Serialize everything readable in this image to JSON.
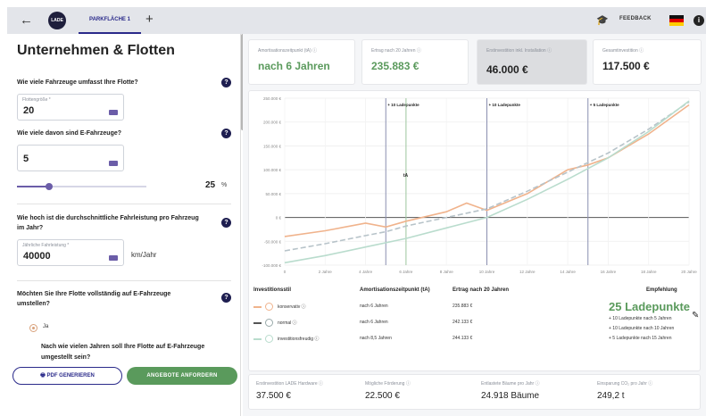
{
  "topbar": {
    "logo_text": "LADE",
    "tab_label": "PARKFLÄCHE 1",
    "feedback_label": "FEEDBACK"
  },
  "left": {
    "title": "Unternehmen & Flotten",
    "q_fleet": "Wie viele Fahrzeuge umfasst Ihre Flotte?",
    "fleet_label": "Flottengröße *",
    "fleet_value": "20",
    "q_ev": "Wie viele davon sind E-Fahrzeuge?",
    "ev_value": "5",
    "ev_share": 25,
    "ev_share_text": "25",
    "pct_sign": "%",
    "q_mileage": "Wie hoch ist die durchschnittliche Fahrleistung pro Fahrzeug im Jahr?",
    "mileage_label": "Jährliche Fahrleistung *",
    "mileage_value": "40000",
    "mileage_unit": "km/Jahr",
    "q_full": "Möchten Sie Ihre Flotte vollständig auf E-Fahrzeuge umstellen?",
    "radio_yes": "Ja",
    "q_years": "Nach wie vielen Jahren soll Ihre Flotte auf E-Fahrzeuge umgestellt sein?",
    "btn_pdf": "PDF GENERIEREN",
    "btn_offer": "ANGEBOTE ANFORDERN"
  },
  "cards": [
    {
      "label": "Amortisationszeitpunkt (tA) ⓘ",
      "value": "nach 6 Jahren",
      "color": "#5a9a5c"
    },
    {
      "label": "Ertrag nach 20 Jahren ⓘ",
      "value": "235.883 €",
      "color": "#5a9a5c"
    },
    {
      "label": "Erstinvestition inkl. Installation ⓘ",
      "value": "46.000 €",
      "color": "#222222"
    },
    {
      "label": "Gesamtinvestition ⓘ",
      "value": "117.500 €",
      "color": "#222222"
    }
  ],
  "chart_data": {
    "type": "line",
    "x_ticks": [
      "0",
      "2 Jahre",
      "4 Jahre",
      "6 Jahre",
      "8 Jahre",
      "10 Jahre",
      "12 Jahre",
      "14 Jahre",
      "16 Jahre",
      "18 Jahre",
      "20 Jahre"
    ],
    "y_ticks": [
      "250.000 €",
      "200.000 €",
      "150.000 €",
      "100.000 €",
      "50.000 €",
      "0 €",
      "-50.000 €",
      "-100.000 €"
    ],
    "ylim": [
      -100000,
      250000
    ],
    "xlim": [
      0,
      20
    ],
    "marker_label": "tA",
    "marker_x": 6,
    "vlines": [
      {
        "x": 5,
        "label": "+ 10 Ladepunkte"
      },
      {
        "x": 10,
        "label": "+ 10 Ladepunkte"
      },
      {
        "x": 15,
        "label": "+ 5 Ladepunkte"
      }
    ],
    "series": [
      {
        "name": "konservativ",
        "color": "#f0b38c",
        "style": "solid",
        "x": [
          0,
          2,
          4,
          5,
          6,
          8,
          9,
          10,
          12,
          14,
          15,
          16,
          18,
          20
        ],
        "y": [
          -40000,
          -28000,
          -12000,
          -20000,
          -8000,
          12000,
          30000,
          15000,
          50000,
          100000,
          110000,
          125000,
          175000,
          235883
        ]
      },
      {
        "name": "normal",
        "color": "#b7c3c9",
        "style": "dashed",
        "x": [
          0,
          2,
          4,
          5,
          6,
          8,
          10,
          12,
          14,
          16,
          18,
          20
        ],
        "y": [
          -70000,
          -55000,
          -38000,
          -30000,
          -18000,
          0,
          18000,
          55000,
          95000,
          135000,
          185000,
          242133
        ]
      },
      {
        "name": "investitionsfreudig",
        "color": "#b9dccd",
        "style": "solid",
        "x": [
          0,
          2,
          4,
          6,
          8,
          10,
          12,
          14,
          16,
          18,
          20
        ],
        "y": [
          -95000,
          -80000,
          -62000,
          -44000,
          -22000,
          0,
          38000,
          80000,
          125000,
          180000,
          244133
        ]
      }
    ]
  },
  "table": {
    "h_style": "Investitionsstil",
    "h_ta": "Amortisationszeitpunkt (tA)",
    "h_yield": "Ertrag nach 20 Jahren",
    "h_rec": "Empfehlung",
    "rows": [
      {
        "name": "konservativ ⓘ",
        "ta": "nach 6 Jahren",
        "yield": "235.883 €"
      },
      {
        "name": "normal ⓘ",
        "ta": "nach 6 Jahren",
        "yield": "242.133 €"
      },
      {
        "name": "investitionsfreudig ⓘ",
        "ta": "nach 8,5 Jahren",
        "yield": "244.133 €"
      }
    ],
    "rec_big": "25 Ladepunkte",
    "rec_lines": [
      "+ 10 Ladepunkte nach 5 Jahren",
      "+ 10 Ladepunkte nach 10 Jahren",
      "+ 5 Ladepunkte nach 15 Jahren"
    ]
  },
  "bottom": [
    {
      "label": "Erstinvestition LADE Hardware ⓘ",
      "value": "37.500 €"
    },
    {
      "label": "Mögliche Förderung ⓘ",
      "value": "22.500 €"
    },
    {
      "label": "Entlastete Bäume pro Jahr ⓘ",
      "value": "24.918 Bäume"
    },
    {
      "label": "Einsparung CO₂ pro Jahr ⓘ",
      "value": "249,2 t"
    }
  ]
}
